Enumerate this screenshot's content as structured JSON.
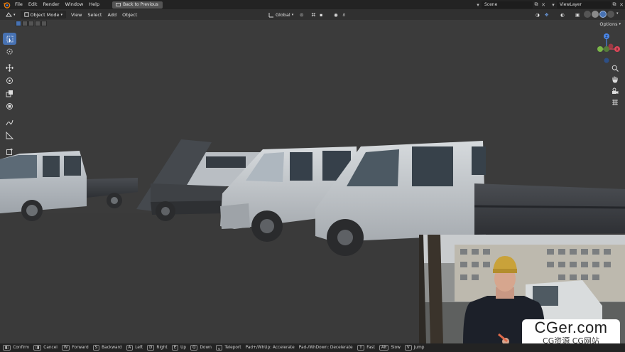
{
  "topbar": {
    "logo_icon": "blender-logo-icon",
    "menus": [
      "File",
      "Edit",
      "Render",
      "Window",
      "Help"
    ],
    "back_button": "Back to Previous",
    "scene": "Scene",
    "view_layer": "ViewLayer"
  },
  "header": {
    "editor_icon": "3d-viewport-icon",
    "mode": "Object Mode",
    "menus": [
      "View",
      "Select",
      "Add",
      "Object"
    ],
    "orientation": "Global",
    "options": "Options"
  },
  "toolbar": {
    "tools": [
      "select-box-icon",
      "cursor-icon",
      "move-icon",
      "rotate-icon",
      "scale-icon",
      "transform-icon",
      "annotate-icon",
      "measure-icon",
      "add-cube-icon"
    ]
  },
  "navigation": {
    "gizmo_axes": [
      "Z",
      "Y",
      "X"
    ],
    "colors": {
      "x": "#e0485a",
      "y": "#7ab648",
      "z": "#4a86e8"
    },
    "icons": [
      "zoom-icon",
      "hand-pan-icon",
      "camera-icon",
      "grid-icon"
    ]
  },
  "watermark": {
    "main": "CGer.com",
    "sub": "CG资源 CG网站"
  },
  "statusbar": {
    "items": [
      {
        "key": "",
        "label": "Confirm"
      },
      {
        "key": "",
        "label": "Cancel"
      },
      {
        "key": "W",
        "label": "Forward"
      },
      {
        "key": "S",
        "label": "Backward"
      },
      {
        "key": "A",
        "label": "Left"
      },
      {
        "key": "D",
        "label": "Right"
      },
      {
        "key": "E",
        "label": "Up"
      },
      {
        "key": "Q",
        "label": "Down"
      },
      {
        "key": "",
        "label": "Teleport"
      },
      {
        "key": "",
        "label": "Pad+/WhUp: Accelerate"
      },
      {
        "key": "",
        "label": "Pad-/WhDown: Decelerate"
      },
      {
        "key": "",
        "label": "Fast"
      },
      {
        "key": "Alt",
        "label": "Slow"
      },
      {
        "key": "V",
        "label": "Jump"
      }
    ]
  },
  "accent_color": "#4772b3"
}
